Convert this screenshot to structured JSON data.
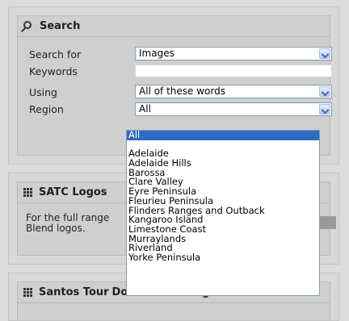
{
  "search_panel": {
    "title": "Search",
    "search_for": {
      "label": "Search for",
      "value": "Images"
    },
    "keywords": {
      "label": "Keywords",
      "value": ""
    },
    "using": {
      "label": "Using",
      "value": "All of these words"
    },
    "region": {
      "label": "Region",
      "value": "All"
    }
  },
  "region_dropdown": {
    "options": [
      "All",
      "",
      "Adelaide",
      "Adelaide Hills",
      "Barossa",
      "Clare Valley",
      "Eyre Peninsula",
      "Fleurieu Peninsula",
      "Flinders Ranges and Outback",
      "Kangaroo Island",
      "Limestone Coast",
      "Murraylands",
      "Riverland",
      "Yorke Peninsula"
    ],
    "selected_index": 0
  },
  "satc_panel": {
    "title": "SATC Logos",
    "body_line1": "For the full range",
    "body_line2": "Blend logos."
  },
  "santos_panel": {
    "title": "Santos Tour",
    "title_tail": "Down Under Logos"
  },
  "colors": {
    "selection": "#316ac5",
    "select_border": "#7f9db9"
  }
}
